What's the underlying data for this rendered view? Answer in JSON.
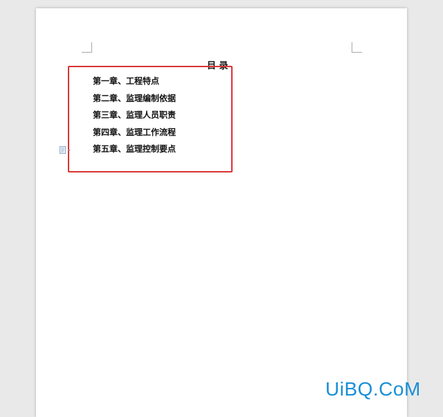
{
  "document": {
    "toc_title": "目 录",
    "chapters": [
      {
        "label": "第一章、工程特点"
      },
      {
        "label": "第二章、监理编制依据"
      },
      {
        "label": "第三章、监理人员职责"
      },
      {
        "label": "第四章、监理工作流程"
      },
      {
        "label": "第五章、监理控制要点"
      }
    ]
  },
  "icons": {
    "paragraph_options": "paragraph-layout-icon"
  },
  "colors": {
    "highlight_border": "#d93232",
    "watermark": "#1a8fd6",
    "canvas_background": "#e9e9e9",
    "page_background": "#ffffff"
  },
  "watermark": {
    "text": "UiBQ.CoM"
  }
}
